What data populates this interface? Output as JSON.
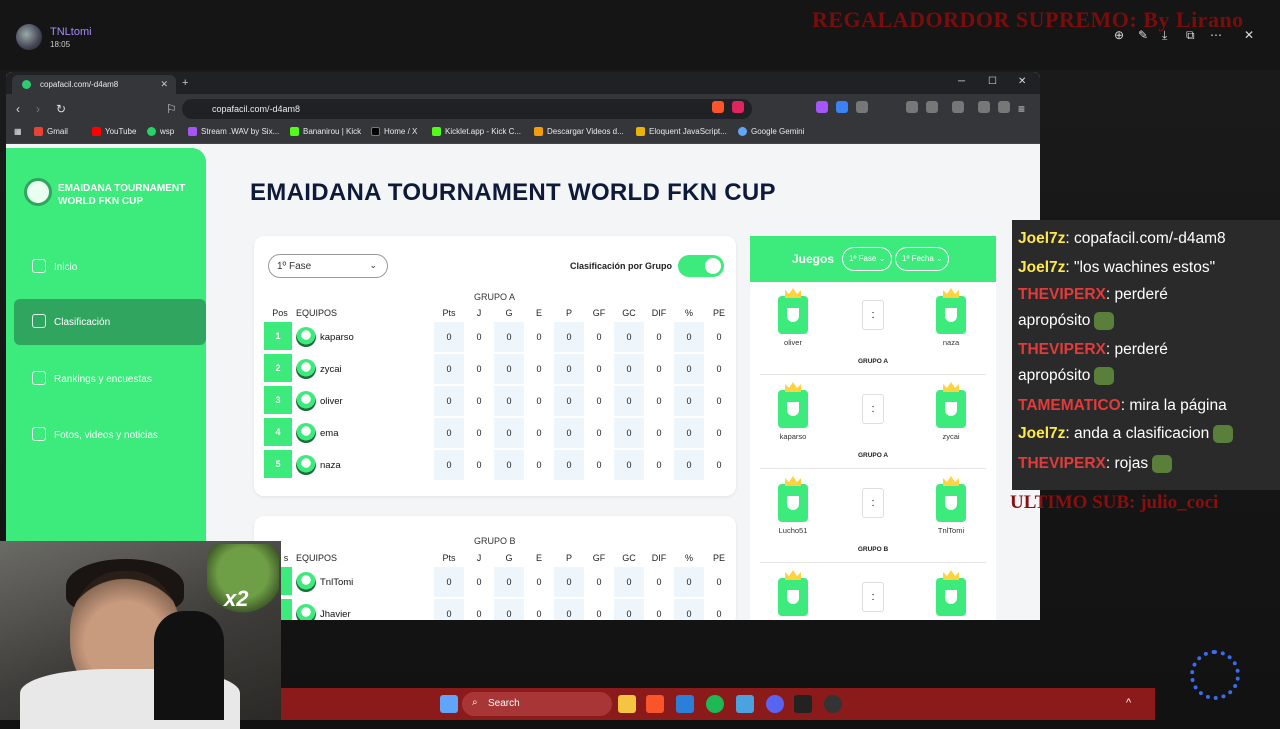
{
  "stream": {
    "streamer_name": "TNLtomi",
    "time": "18:05",
    "banner": "REGALADORDOR SUPREMO: By Lirano",
    "last_sub": "ULTIMO SUB: julio_coci",
    "overlay_x2": "x2"
  },
  "browser": {
    "tab_title": "copafacil.com/-d4am8",
    "url": "copafacil.com/-d4am8",
    "bookmarks": [
      "Gmail",
      "YouTube",
      "wsp",
      "Stream .WAV by Six...",
      "Bananirou | Kick",
      "Home / X",
      "Kicklet.app - Kick C...",
      "Descargar Videos d...",
      "Eloquent JavaScript...",
      "Google Gemini"
    ]
  },
  "sidebar": {
    "brand": "EMAIDANA TOURNAMENT WORLD FKN CUP",
    "items": [
      {
        "label": "Inicio"
      },
      {
        "label": "Clasificación"
      },
      {
        "label": "Rankings y encuestas"
      },
      {
        "label": "Fotos, videos y noticias"
      }
    ]
  },
  "main": {
    "title": "EMAIDANA TOURNAMENT WORLD FKN CUP",
    "phase_select": "1º Fase",
    "toggle_label": "Clasificación por Grupo",
    "columns": [
      "Pos",
      "EQUIPOS",
      "Pts",
      "J",
      "G",
      "E",
      "P",
      "GF",
      "GC",
      "DIF",
      "%",
      "PE"
    ],
    "group_a": {
      "name": "GRUPO A",
      "rows": [
        {
          "pos": "1",
          "team": "kaparso",
          "stats": [
            "0",
            "0",
            "0",
            "0",
            "0",
            "0",
            "0",
            "0",
            "0",
            "0"
          ]
        },
        {
          "pos": "2",
          "team": "zycai",
          "stats": [
            "0",
            "0",
            "0",
            "0",
            "0",
            "0",
            "0",
            "0",
            "0",
            "0"
          ]
        },
        {
          "pos": "3",
          "team": "oliver",
          "stats": [
            "0",
            "0",
            "0",
            "0",
            "0",
            "0",
            "0",
            "0",
            "0",
            "0"
          ]
        },
        {
          "pos": "4",
          "team": "ema",
          "stats": [
            "0",
            "0",
            "0",
            "0",
            "0",
            "0",
            "0",
            "0",
            "0",
            "0"
          ]
        },
        {
          "pos": "5",
          "team": "naza",
          "stats": [
            "0",
            "0",
            "0",
            "0",
            "0",
            "0",
            "0",
            "0",
            "0",
            "0"
          ]
        }
      ]
    },
    "group_b": {
      "name": "GRUPO B",
      "pos_header": "s",
      "rows": [
        {
          "team": "TnlTomi",
          "stats": [
            "0",
            "0",
            "0",
            "0",
            "0",
            "0",
            "0",
            "0",
            "0",
            "0"
          ]
        },
        {
          "team": "Jhavier",
          "stats": [
            "0",
            "0",
            "0",
            "0",
            "0",
            "0",
            "0",
            "0",
            "0",
            "0"
          ]
        }
      ]
    }
  },
  "juegos": {
    "title": "Juegos",
    "phase": "1º Fase",
    "date": "1º Fecha",
    "score_sep": ":",
    "matches": [
      {
        "home": "oliver",
        "away": "naza",
        "group": "GRUPO A"
      },
      {
        "home": "kaparso",
        "away": "zycai",
        "group": "GRUPO A"
      },
      {
        "home": "Lucho51",
        "away": "TnlTomi",
        "group": "GRUPO B"
      },
      {
        "home": "",
        "away": "",
        "group": ""
      }
    ]
  },
  "chat": [
    {
      "user": "Joel7z",
      "user_color": "#ffe94a",
      "text": ": copafacil.com/-d4am8"
    },
    {
      "user": "Joel7z",
      "user_color": "#ffe94a",
      "text": ": \"los wachines estos\""
    },
    {
      "user": "THEVIPERX",
      "user_color": "#e23b3b",
      "text": ": perderé"
    },
    {
      "user": "",
      "user_color": "",
      "text": "apropósito"
    },
    {
      "user": "THEVIPERX",
      "user_color": "#e23b3b",
      "text": ": perderé"
    },
    {
      "user": "",
      "user_color": "",
      "text": "apropósito"
    },
    {
      "user": "TAMEMATICO",
      "user_color": "#e23b3b",
      "text": ": mira la página"
    },
    {
      "user": "Joel7z",
      "user_color": "#ffe94a",
      "text": ": anda a clasificacion"
    },
    {
      "user": "THEVIPERX",
      "user_color": "#e23b3b",
      "text": ": rojas"
    }
  ],
  "taskbar": {
    "search_placeholder": "Search"
  },
  "colors": {
    "accent": "#3dea7c",
    "accent_dark": "#2fa55f",
    "title": "#0e1a3a",
    "taskbar": "#8b1a1a"
  }
}
